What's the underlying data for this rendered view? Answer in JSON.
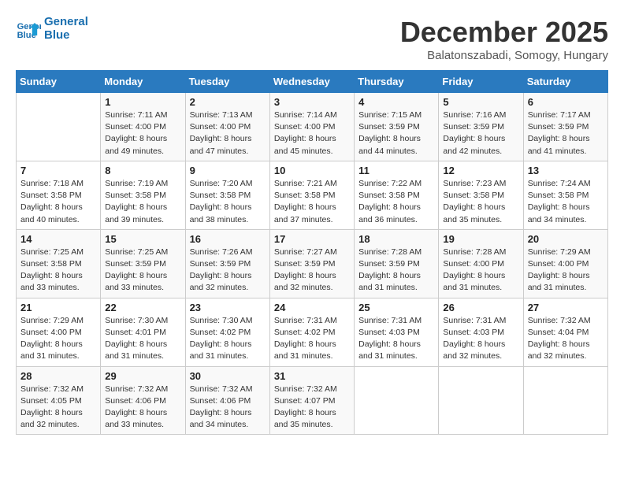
{
  "logo": {
    "line1": "General",
    "line2": "Blue"
  },
  "title": "December 2025",
  "subtitle": "Balatonszabadi, Somogy, Hungary",
  "days_header": [
    "Sunday",
    "Monday",
    "Tuesday",
    "Wednesday",
    "Thursday",
    "Friday",
    "Saturday"
  ],
  "weeks": [
    [
      {
        "day": "",
        "info": ""
      },
      {
        "day": "1",
        "info": "Sunrise: 7:11 AM\nSunset: 4:00 PM\nDaylight: 8 hours\nand 49 minutes."
      },
      {
        "day": "2",
        "info": "Sunrise: 7:13 AM\nSunset: 4:00 PM\nDaylight: 8 hours\nand 47 minutes."
      },
      {
        "day": "3",
        "info": "Sunrise: 7:14 AM\nSunset: 4:00 PM\nDaylight: 8 hours\nand 45 minutes."
      },
      {
        "day": "4",
        "info": "Sunrise: 7:15 AM\nSunset: 3:59 PM\nDaylight: 8 hours\nand 44 minutes."
      },
      {
        "day": "5",
        "info": "Sunrise: 7:16 AM\nSunset: 3:59 PM\nDaylight: 8 hours\nand 42 minutes."
      },
      {
        "day": "6",
        "info": "Sunrise: 7:17 AM\nSunset: 3:59 PM\nDaylight: 8 hours\nand 41 minutes."
      }
    ],
    [
      {
        "day": "7",
        "info": "Sunrise: 7:18 AM\nSunset: 3:58 PM\nDaylight: 8 hours\nand 40 minutes."
      },
      {
        "day": "8",
        "info": "Sunrise: 7:19 AM\nSunset: 3:58 PM\nDaylight: 8 hours\nand 39 minutes."
      },
      {
        "day": "9",
        "info": "Sunrise: 7:20 AM\nSunset: 3:58 PM\nDaylight: 8 hours\nand 38 minutes."
      },
      {
        "day": "10",
        "info": "Sunrise: 7:21 AM\nSunset: 3:58 PM\nDaylight: 8 hours\nand 37 minutes."
      },
      {
        "day": "11",
        "info": "Sunrise: 7:22 AM\nSunset: 3:58 PM\nDaylight: 8 hours\nand 36 minutes."
      },
      {
        "day": "12",
        "info": "Sunrise: 7:23 AM\nSunset: 3:58 PM\nDaylight: 8 hours\nand 35 minutes."
      },
      {
        "day": "13",
        "info": "Sunrise: 7:24 AM\nSunset: 3:58 PM\nDaylight: 8 hours\nand 34 minutes."
      }
    ],
    [
      {
        "day": "14",
        "info": "Sunrise: 7:25 AM\nSunset: 3:58 PM\nDaylight: 8 hours\nand 33 minutes."
      },
      {
        "day": "15",
        "info": "Sunrise: 7:25 AM\nSunset: 3:59 PM\nDaylight: 8 hours\nand 33 minutes."
      },
      {
        "day": "16",
        "info": "Sunrise: 7:26 AM\nSunset: 3:59 PM\nDaylight: 8 hours\nand 32 minutes."
      },
      {
        "day": "17",
        "info": "Sunrise: 7:27 AM\nSunset: 3:59 PM\nDaylight: 8 hours\nand 32 minutes."
      },
      {
        "day": "18",
        "info": "Sunrise: 7:28 AM\nSunset: 3:59 PM\nDaylight: 8 hours\nand 31 minutes."
      },
      {
        "day": "19",
        "info": "Sunrise: 7:28 AM\nSunset: 4:00 PM\nDaylight: 8 hours\nand 31 minutes."
      },
      {
        "day": "20",
        "info": "Sunrise: 7:29 AM\nSunset: 4:00 PM\nDaylight: 8 hours\nand 31 minutes."
      }
    ],
    [
      {
        "day": "21",
        "info": "Sunrise: 7:29 AM\nSunset: 4:00 PM\nDaylight: 8 hours\nand 31 minutes."
      },
      {
        "day": "22",
        "info": "Sunrise: 7:30 AM\nSunset: 4:01 PM\nDaylight: 8 hours\nand 31 minutes."
      },
      {
        "day": "23",
        "info": "Sunrise: 7:30 AM\nSunset: 4:02 PM\nDaylight: 8 hours\nand 31 minutes."
      },
      {
        "day": "24",
        "info": "Sunrise: 7:31 AM\nSunset: 4:02 PM\nDaylight: 8 hours\nand 31 minutes."
      },
      {
        "day": "25",
        "info": "Sunrise: 7:31 AM\nSunset: 4:03 PM\nDaylight: 8 hours\nand 31 minutes."
      },
      {
        "day": "26",
        "info": "Sunrise: 7:31 AM\nSunset: 4:03 PM\nDaylight: 8 hours\nand 32 minutes."
      },
      {
        "day": "27",
        "info": "Sunrise: 7:32 AM\nSunset: 4:04 PM\nDaylight: 8 hours\nand 32 minutes."
      }
    ],
    [
      {
        "day": "28",
        "info": "Sunrise: 7:32 AM\nSunset: 4:05 PM\nDaylight: 8 hours\nand 32 minutes."
      },
      {
        "day": "29",
        "info": "Sunrise: 7:32 AM\nSunset: 4:06 PM\nDaylight: 8 hours\nand 33 minutes."
      },
      {
        "day": "30",
        "info": "Sunrise: 7:32 AM\nSunset: 4:06 PM\nDaylight: 8 hours\nand 34 minutes."
      },
      {
        "day": "31",
        "info": "Sunrise: 7:32 AM\nSunset: 4:07 PM\nDaylight: 8 hours\nand 35 minutes."
      },
      {
        "day": "",
        "info": ""
      },
      {
        "day": "",
        "info": ""
      },
      {
        "day": "",
        "info": ""
      }
    ]
  ]
}
